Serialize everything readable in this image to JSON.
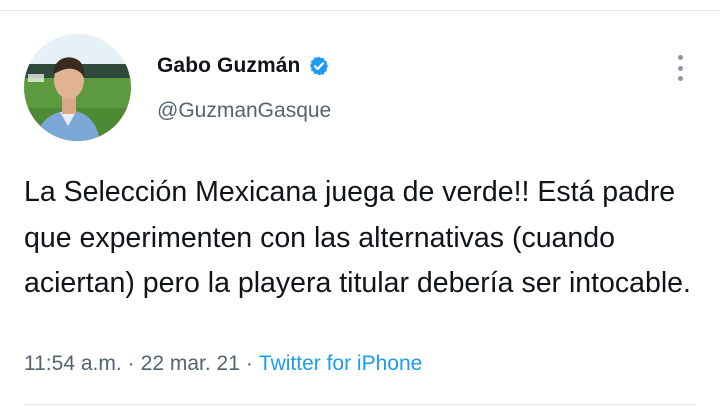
{
  "tweet": {
    "author": {
      "display_name": "Gabo Guzmán",
      "handle": "@GuzmanGasque",
      "verified": true
    },
    "text": "La Selección Mexicana juega de verde!! Está padre que experimenten con las alternativas (cuando aciertan) pero la playera titular debería ser intocable.",
    "time": "11:54 a.m.",
    "date": "22 mar. 21",
    "separator": "·",
    "source": "Twitter for iPhone"
  },
  "icons": {
    "verified": "verified-badge-icon",
    "more": "more-options-icon"
  },
  "colors": {
    "text_primary": "#0f1419",
    "text_secondary": "#536471",
    "accent": "#1d9bf0",
    "divider": "#e1e6ea"
  }
}
